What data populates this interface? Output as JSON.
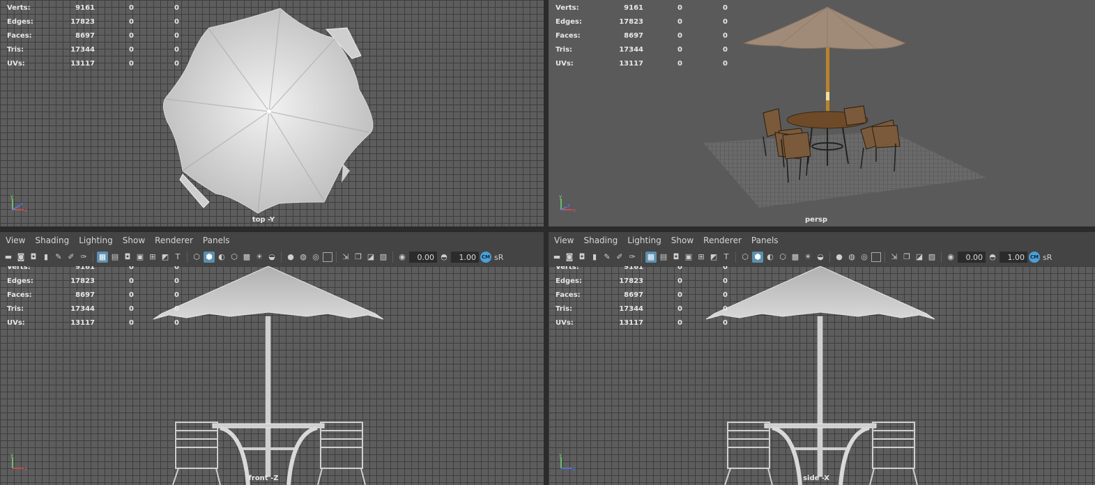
{
  "stats": [
    {
      "label": "Verts:",
      "v1": "9161",
      "v2": "0",
      "v3": "0"
    },
    {
      "label": "Edges:",
      "v1": "17823",
      "v2": "0",
      "v3": "0"
    },
    {
      "label": "Faces:",
      "v1": "8697",
      "v2": "0",
      "v3": "0"
    },
    {
      "label": "Tris:",
      "v1": "17344",
      "v2": "0",
      "v3": "0"
    },
    {
      "label": "UVs:",
      "v1": "13117",
      "v2": "0",
      "v3": "0"
    }
  ],
  "viewports": {
    "top": {
      "camera": "top -Y"
    },
    "persp": {
      "camera": "persp"
    },
    "front": {
      "camera": "front -Z"
    },
    "side": {
      "camera": "side -X"
    }
  },
  "menu": [
    "View",
    "Shading",
    "Lighting",
    "Show",
    "Renderer",
    "Panels"
  ],
  "toolbar": {
    "exposure": "0.00",
    "gamma": "1.00",
    "color_mgmt_badge": "CM",
    "srgb": "sR"
  },
  "axis": {
    "x": "x",
    "y": "y",
    "z": "z"
  },
  "colors": {
    "grid_bg": "#5d5d5d",
    "grid_line": "#3e3e3e",
    "menu_bg": "#444444",
    "highlight": "#5b8fb0",
    "umbrella_persp": "#a08a78",
    "wood": "#7a5a3a"
  }
}
